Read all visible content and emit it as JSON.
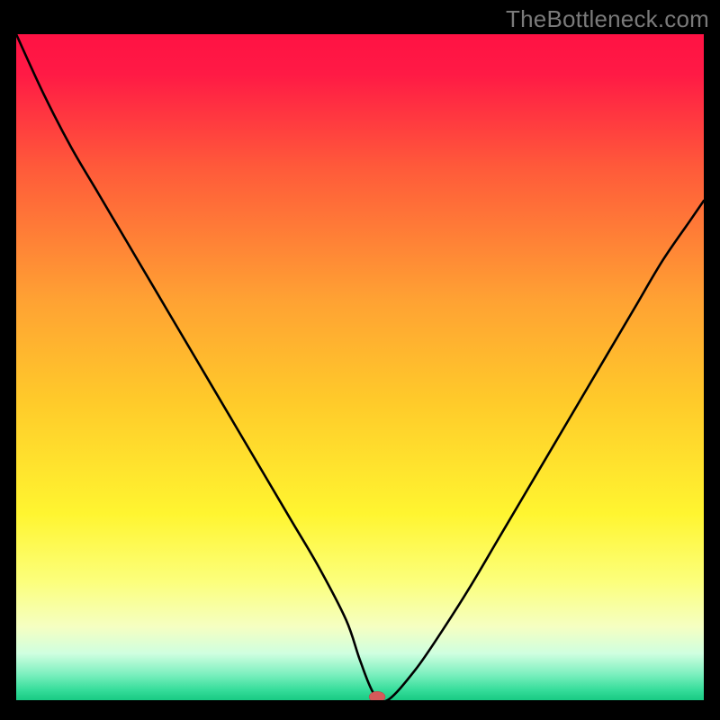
{
  "watermark": "TheBottleneck.com",
  "chart_data": {
    "type": "line",
    "title": "",
    "xlabel": "",
    "ylabel": "",
    "xlim": [
      0,
      100
    ],
    "ylim": [
      0,
      100
    ],
    "background_gradient": [
      {
        "stop": 0.0,
        "color": "#ff1244"
      },
      {
        "stop": 0.06,
        "color": "#ff1a45"
      },
      {
        "stop": 0.2,
        "color": "#ff5a3a"
      },
      {
        "stop": 0.4,
        "color": "#ffa233"
      },
      {
        "stop": 0.55,
        "color": "#ffca2a"
      },
      {
        "stop": 0.72,
        "color": "#fff530"
      },
      {
        "stop": 0.82,
        "color": "#fcff7a"
      },
      {
        "stop": 0.89,
        "color": "#f5ffc2"
      },
      {
        "stop": 0.93,
        "color": "#cfffe0"
      },
      {
        "stop": 0.96,
        "color": "#7ff0c0"
      },
      {
        "stop": 0.985,
        "color": "#35dd9a"
      },
      {
        "stop": 1.0,
        "color": "#18c983"
      }
    ],
    "series": [
      {
        "name": "bottleneck-curve",
        "x": [
          0,
          4,
          8,
          12,
          16,
          20,
          24,
          28,
          32,
          36,
          40,
          44,
          48,
          50,
          52,
          54,
          58,
          62,
          66,
          70,
          74,
          78,
          82,
          86,
          90,
          94,
          98,
          100
        ],
        "y": [
          100,
          91,
          83,
          76,
          69,
          62,
          55,
          48,
          41,
          34,
          27,
          20,
          12,
          6,
          1,
          0,
          4.5,
          10.5,
          17,
          24,
          31,
          38,
          45,
          52,
          59,
          66,
          72,
          75
        ]
      }
    ],
    "marker": {
      "name": "current-setup-marker",
      "x": 52.5,
      "y": 0.5,
      "color": "#d65a5a",
      "rx": 9,
      "ry": 6
    }
  }
}
